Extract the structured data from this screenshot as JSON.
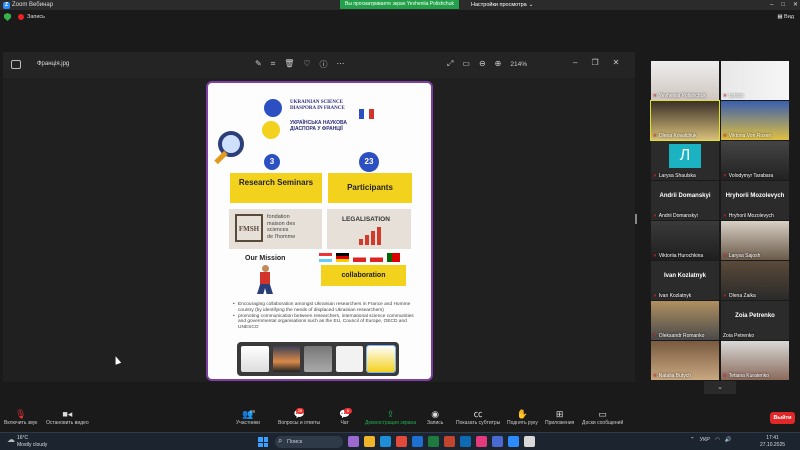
{
  "titlebar": {
    "app_title": "Zoom Вебинар",
    "banner": "Вы просматриваете экран Yevheniia Polishchuk",
    "view_options": "Настройки просмотра"
  },
  "secbar": {
    "recording": "Запись",
    "view": "Вид"
  },
  "viewer": {
    "filename": "Франція.jpg",
    "zoom": "214%",
    "icons": [
      "edit-icon",
      "crop-icon",
      "delete-icon",
      "heart-icon",
      "info-icon",
      "more-icon",
      "expand-icon",
      "fit-icon",
      "zoom-out-icon",
      "zoom-in-icon"
    ]
  },
  "poster": {
    "title_en_1": "UKRAINIAN SCIENCE",
    "title_en_2": "DIASPORA IN FRANCE",
    "title_ua_1": "УКРАЇНСЬКА НАУКОВА",
    "title_ua_2": "ДІАСПОРА У ФРАНЦІЇ",
    "num_seminars": "3",
    "label_seminars": "Research Seminars",
    "num_participants": "23",
    "label_participants": "Participants",
    "fmsh_logo": "FMSH",
    "fmsh_text_1": "fondation",
    "fmsh_text_2": "maison des",
    "fmsh_text_3": "sciences",
    "fmsh_text_4": "de l'homme",
    "legalisation": "LEGALISATION",
    "mission": "Our Mission",
    "collaboration": "collaboration",
    "bullets": [
      "Encouraging collaboration amongst Ukrainian researchers in France and Homme country (by identifying the needs of displaced Ukrainian researchers)",
      "promoting communication between researchers, international science communities and governmental organisations such as the EU, Council of Europe, OECD and UNESCO"
    ]
  },
  "participants": [
    {
      "name": "Yevheniia Polishchuk",
      "muted": true
    },
    {
      "name": "Lyman",
      "muted": true
    },
    {
      "name": "Olena Kovalchuk",
      "muted": true
    },
    {
      "name": "Viktoria Von Rosen",
      "muted": true
    },
    {
      "name": "Larysa Shaulska",
      "muted": true
    },
    {
      "name": "Volodymyr Tarabara",
      "muted": true
    },
    {
      "name": "Andrii Domanskyi",
      "muted": true,
      "big": "Andrii Domanskyi"
    },
    {
      "name": "Hryhorii Mozolevych",
      "muted": true,
      "big": "Hryhorii Mozolevych"
    },
    {
      "name": "Viktoriia Hurochkina",
      "muted": true
    },
    {
      "name": "Larysa Sajosh",
      "muted": true
    },
    {
      "name": "Ivan Kozlatnyk",
      "muted": true,
      "big": "Ivan Kozlatnyk"
    },
    {
      "name": "Olena Zaika",
      "muted": true
    },
    {
      "name": "Oleksandr Romanko",
      "muted": true
    },
    {
      "name": "Zoia Petrenko",
      "muted": false,
      "big": "Zoia Petrenko"
    },
    {
      "name": "Natalia Butych",
      "muted": true
    },
    {
      "name": "Tetiana Kuratenko",
      "muted": true
    }
  ],
  "toolbar": {
    "audio": "Включить звук",
    "video": "Остановить видео",
    "participants": "Участники",
    "participants_count": "99",
    "qa": "Вопросы и ответы",
    "qa_badge": "26",
    "chat": "Чат",
    "chat_badge": "6",
    "share": "Демонстрация экрана",
    "record": "Запись",
    "subtitles": "Показать субтитры",
    "raise_hand": "Поднять руку",
    "apps": "Приложения",
    "whiteboards": "Доски сообщений",
    "leave": "Выйти"
  },
  "taskbar": {
    "temp": "16°C",
    "weather": "Mostly cloudy",
    "search": "Поиск",
    "lang": "УКР",
    "time": "17:41",
    "date": "27.10.2025"
  },
  "colors": {
    "accent": "#2d8cff",
    "share_green": "#23a04a",
    "leave_red": "#e02828",
    "poster_border": "#7e3fa3"
  }
}
